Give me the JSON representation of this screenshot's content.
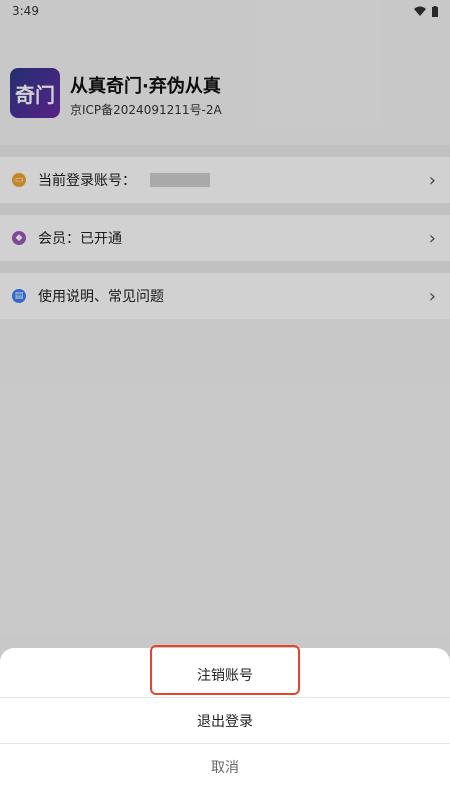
{
  "status": {
    "time": "3:49"
  },
  "app": {
    "icon_text": "奇门",
    "title": "从真奇门·弃伪从真",
    "icp": "京ICP备2024091211号-2A"
  },
  "rows": [
    {
      "label": "当前登录账号：",
      "icon": "id-card-icon",
      "color": "#f0a530"
    },
    {
      "label": "会员：已开通",
      "icon": "diamond-icon",
      "color": "#9b59b6"
    },
    {
      "label": "使用说明、常见问题",
      "icon": "document-icon",
      "color": "#3b82f6"
    }
  ],
  "sheet": {
    "cancel_account": "注销账号",
    "logout": "退出登录",
    "cancel": "取消"
  }
}
